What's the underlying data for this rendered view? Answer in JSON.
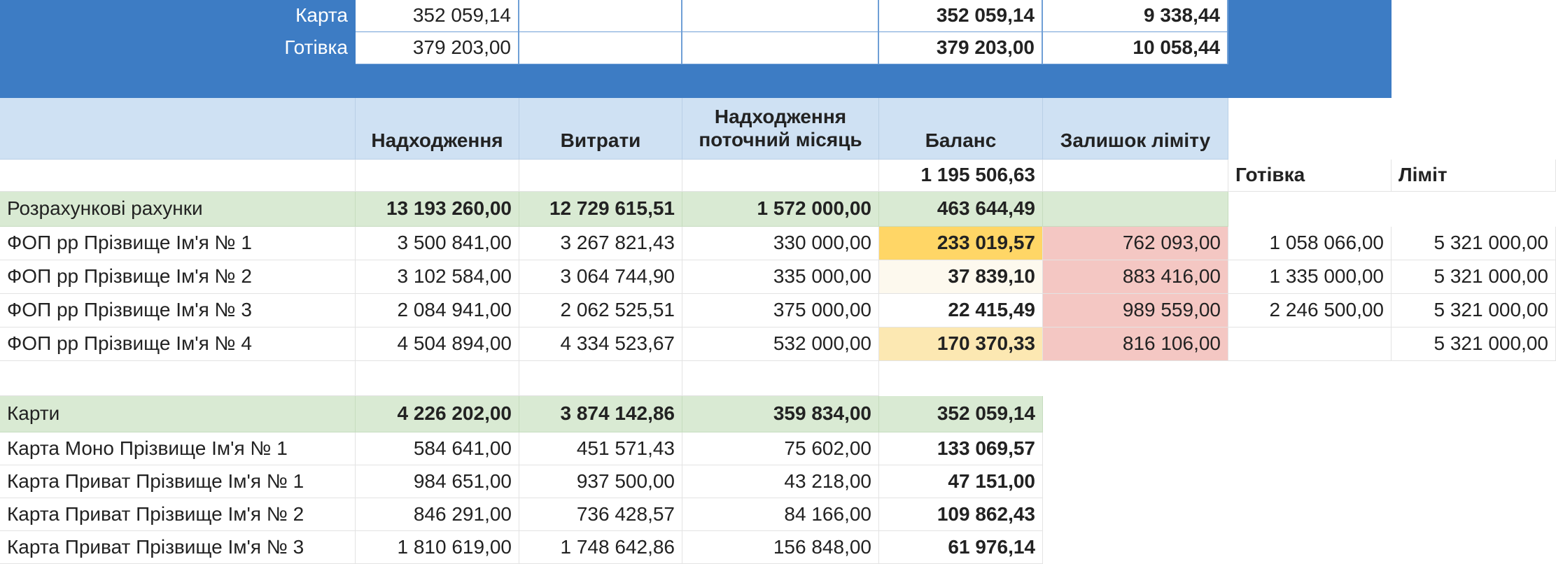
{
  "top": {
    "rows": [
      {
        "label": "Карта",
        "value": "352 059,14",
        "balance": "352 059,14",
        "limit_left": "9 338,44"
      },
      {
        "label": "Готівка",
        "value": "379 203,00",
        "balance": "379 203,00",
        "limit_left": "10 058,44"
      }
    ]
  },
  "header": {
    "income": "Надходження",
    "expenses": "Витрати",
    "income_month": "Надходження поточний місяць",
    "balance": "Баланс",
    "limit_left": "Залишок ліміту"
  },
  "total": {
    "balance": "1 195 506,63",
    "cash_label": "Готівка",
    "limit_label": "Ліміт"
  },
  "accounts": {
    "group": {
      "label": "Розрахункові рахунки",
      "income": "13 193 260,00",
      "expenses": "12 729 615,51",
      "month": "1 572 000,00",
      "balance": "463 644,49"
    },
    "rows": [
      {
        "name": "ФОП рр Прізвище Ім'я № 1",
        "income": "3 500 841,00",
        "expenses": "3 267 821,43",
        "month": "330 000,00",
        "balance": "233 019,57",
        "limit_left": "762 093,00",
        "cash": "1 058 066,00",
        "limit": "5 321 000,00"
      },
      {
        "name": "ФОП рр Прізвище Ім'я № 2",
        "income": "3 102 584,00",
        "expenses": "3 064 744,90",
        "month": "335 000,00",
        "balance": "37 839,10",
        "limit_left": "883 416,00",
        "cash": "1 335 000,00",
        "limit": "5 321 000,00"
      },
      {
        "name": "ФОП рр Прізвище Ім'я № 3",
        "income": "2 084 941,00",
        "expenses": "2 062 525,51",
        "month": "375 000,00",
        "balance": "22 415,49",
        "limit_left": "989 559,00",
        "cash": "2 246 500,00",
        "limit": "5 321 000,00"
      },
      {
        "name": "ФОП рр Прізвище Ім'я № 4",
        "income": "4 504 894,00",
        "expenses": "4 334 523,67",
        "month": "532 000,00",
        "balance": "170 370,33",
        "limit_left": "816 106,00",
        "cash": "",
        "limit": "5 321 000,00"
      }
    ]
  },
  "cards": {
    "group": {
      "label": "Карти",
      "income": "4 226 202,00",
      "expenses": "3 874 142,86",
      "month": "359 834,00",
      "balance": "352 059,14"
    },
    "rows": [
      {
        "name": "Карта Моно Прізвище Ім'я № 1",
        "income": "584 641,00",
        "expenses": "451 571,43",
        "month": "75 602,00",
        "balance": "133 069,57"
      },
      {
        "name": "Карта Приват Прізвище Ім'я № 1",
        "income": "984 651,00",
        "expenses": "937 500,00",
        "month": "43 218,00",
        "balance": "47 151,00"
      },
      {
        "name": "Карта Приват Прізвище Ім'я № 2",
        "income": "846 291,00",
        "expenses": "736 428,57",
        "month": "84 166,00",
        "balance": "109 862,43"
      },
      {
        "name": "Карта Приват Прізвище Ім'я № 3",
        "income": "1 810 619,00",
        "expenses": "1 748 642,86",
        "month": "156 848,00",
        "balance": "61 976,14"
      }
    ]
  }
}
